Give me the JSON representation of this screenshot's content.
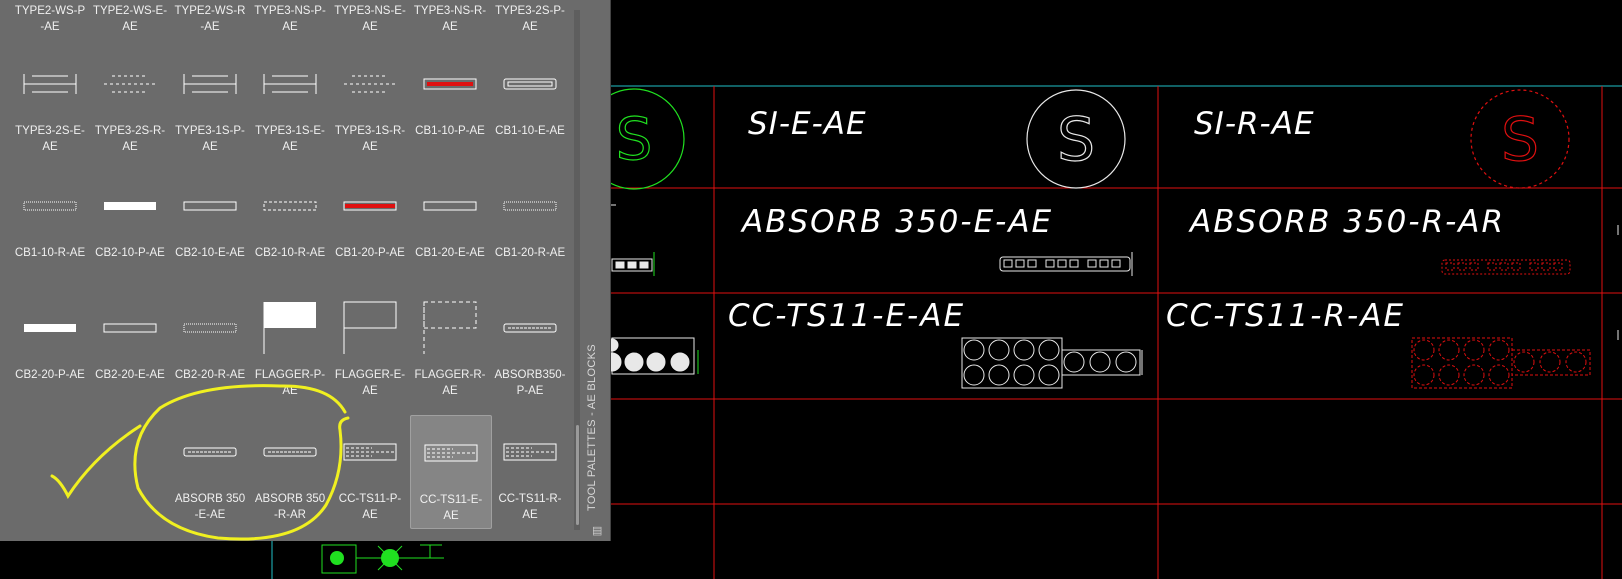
{
  "drawing": {
    "table_titles": [
      "SI-E-AE",
      "SI-R-AE",
      "ABSORB 350-E-AE",
      "ABSORB 350-R-AR",
      "CC-TS11-E-AE",
      "CC-TS11-R-AE"
    ],
    "symbol_letter": "S"
  },
  "palette": {
    "title": "TOOL PALETTES - AE BLOCKS",
    "rows": [
      [
        "TYPE2-WS-P\n-AE",
        "TYPE2-WS-E-\nAE",
        "TYPE2-WS-R\n-AE",
        "TYPE3-NS-P-\nAE",
        "TYPE3-NS-E-\nAE",
        "TYPE3-NS-R-\nAE",
        "TYPE3-2S-P-\nAE"
      ],
      [
        "TYPE3-2S-E-\nAE",
        "TYPE3-2S-R-\nAE",
        "TYPE3-1S-P-\nAE",
        "TYPE3-1S-E-\nAE",
        "TYPE3-1S-R-\nAE",
        "CB1-10-P-AE",
        "CB1-10-E-AE"
      ],
      [
        "CB1-10-R-AE",
        "CB2-10-P-AE",
        "CB2-10-E-AE",
        "CB2-10-R-AE",
        "CB1-20-P-AE",
        "CB1-20-E-AE",
        "CB1-20-R-AE"
      ],
      [
        "CB2-20-P-AE",
        "CB2-20-E-AE",
        "CB2-20-R-AE",
        "FLAGGER-P-\nAE",
        "FLAGGER-E-\nAE",
        "FLAGGER-R-\nAE",
        "ABSORB350-\nP-AE"
      ],
      [
        "",
        "",
        "ABSORB 350\n-E-AE",
        "ABSORB 350\n-R-AR",
        "CC-TS11-P-\nAE",
        "CC-TS11-E-\nAE",
        "CC-TS11-R-\nAE"
      ]
    ],
    "selected_item": "CC-TS11-E-\nAE"
  },
  "colors": {
    "grid_red": "#e01010",
    "grid_cyan": "#20c0c8",
    "symbol_green": "#20e020",
    "highlight_yellow": "#f0f020",
    "palette_bg": "#6b6b6b"
  }
}
